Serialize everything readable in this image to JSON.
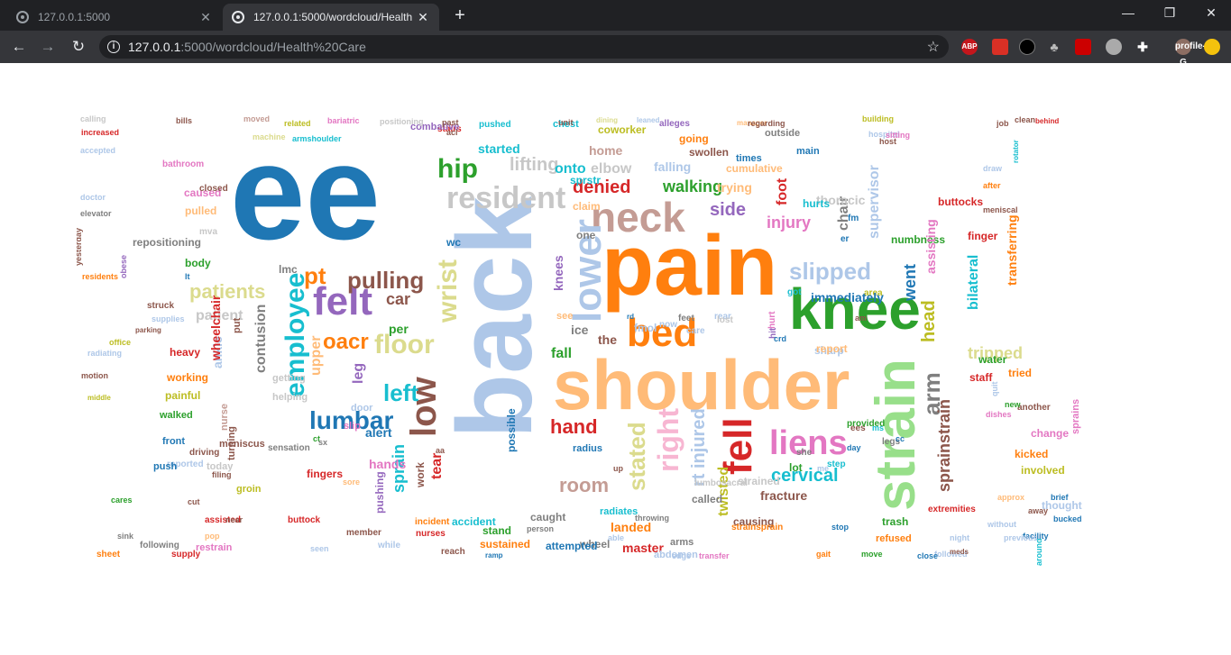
{
  "browser": {
    "tabs": [
      {
        "title": "127.0.0.1:5000",
        "active": false
      },
      {
        "title": "127.0.0.1:5000/wordcloud/Health",
        "active": true
      }
    ],
    "address": {
      "host": "127.0.0.1",
      "path": ":5000/wordcloud/Health%20Care"
    },
    "extensions": [
      "ABP",
      "profile-G"
    ]
  },
  "colors": {
    "tabstrip": "#202124",
    "toolbar": "#35363a",
    "page_bg": "#ffffff"
  },
  "wordcloud": {
    "category": "Health Care",
    "words": [
      {
        "text": "ee",
        "color": "#1f77b4"
      },
      {
        "text": "back",
        "color": "#aec7e8"
      },
      {
        "text": "pain",
        "color": "#ff7f0e"
      },
      {
        "text": "shoulder",
        "color": "#ffbb78"
      },
      {
        "text": "knee",
        "color": "#2ca02c"
      },
      {
        "text": "strain",
        "color": "#98df8a"
      },
      {
        "text": "neck",
        "color": "#c49c94"
      },
      {
        "text": "lower",
        "color": "#aec7e8"
      },
      {
        "text": "felt",
        "color": "#9467bd"
      },
      {
        "text": "bed",
        "color": "#ff7f0e"
      },
      {
        "text": "fell",
        "color": "#d62728"
      },
      {
        "text": "low",
        "color": "#8c564b"
      },
      {
        "text": "resident",
        "color": "#c7c7c7"
      },
      {
        "text": "employee",
        "color": "#17becf"
      },
      {
        "text": "lumbar",
        "color": "#1f77b4"
      },
      {
        "text": "liens",
        "color": "#e377c2"
      },
      {
        "text": "wrist",
        "color": "#dbdb8d"
      },
      {
        "text": "hip",
        "color": "#2ca02c"
      },
      {
        "text": "right",
        "color": "#f7b6d2"
      },
      {
        "text": "arm",
        "color": "#7f7f7f"
      },
      {
        "text": "floor",
        "color": "#dbdb8d"
      },
      {
        "text": "pt",
        "color": "#ff7f0e"
      },
      {
        "text": "pulling",
        "color": "#8c564b"
      },
      {
        "text": "slipped",
        "color": "#aec7e8"
      },
      {
        "text": "patients",
        "color": "#dbdb8d"
      },
      {
        "text": "denied",
        "color": "#d62728"
      },
      {
        "text": "lifting",
        "color": "#c7c7c7"
      },
      {
        "text": "walking",
        "color": "#2ca02c"
      },
      {
        "text": "room",
        "color": "#c49c94"
      },
      {
        "text": "hand",
        "color": "#d62728"
      },
      {
        "text": "left",
        "color": "#17becf"
      },
      {
        "text": "oacr",
        "color": "#ff7f0e"
      },
      {
        "text": "stated",
        "color": "#dbdb8d"
      },
      {
        "text": "rt injured",
        "color": "#aec7e8"
      },
      {
        "text": "cervical",
        "color": "#17becf"
      },
      {
        "text": "sprainstrain",
        "color": "#8c564b"
      },
      {
        "text": "head",
        "color": "#bcbd22"
      },
      {
        "text": "went",
        "color": "#1f77b4"
      },
      {
        "text": "tripped",
        "color": "#dbdb8d"
      },
      {
        "text": "side",
        "color": "#9467bd"
      },
      {
        "text": "injury",
        "color": "#e377c2"
      },
      {
        "text": "foot",
        "color": "#d62728"
      },
      {
        "text": "chair",
        "color": "#7f7f7f"
      },
      {
        "text": "supervisor",
        "color": "#aec7e8"
      },
      {
        "text": "sprain",
        "color": "#17becf"
      },
      {
        "text": "tear",
        "color": "#d62728"
      },
      {
        "text": "twisted",
        "color": "#bcbd22"
      },
      {
        "text": "fracture",
        "color": "#8c564b"
      },
      {
        "text": "bilateral",
        "color": "#17becf"
      },
      {
        "text": "transferring",
        "color": "#ff7f0e"
      },
      {
        "text": "knees",
        "color": "#9467bd"
      },
      {
        "text": "patient",
        "color": "#c7c7c7"
      },
      {
        "text": "contusion",
        "color": "#7f7f7f"
      },
      {
        "text": "upper",
        "color": "#ffbb78"
      },
      {
        "text": "leg",
        "color": "#9467bd"
      },
      {
        "text": "ankle",
        "color": "#aec7e8"
      },
      {
        "text": "wheelchair",
        "color": "#d62728"
      },
      {
        "text": "started",
        "color": "#17becf"
      },
      {
        "text": "home",
        "color": "#c49c94"
      },
      {
        "text": "elbow",
        "color": "#c7c7c7"
      },
      {
        "text": "falling",
        "color": "#aec7e8"
      },
      {
        "text": "trying",
        "color": "#ffbb78"
      },
      {
        "text": "cumulative",
        "color": "#ffbb78"
      },
      {
        "text": "thoracic",
        "color": "#c7c7c7"
      },
      {
        "text": "numbness",
        "color": "#2ca02c"
      },
      {
        "text": "assisting",
        "color": "#e377c2"
      },
      {
        "text": "alert",
        "color": "#1f77b4"
      },
      {
        "text": "hands",
        "color": "#e377c2"
      },
      {
        "text": "fingers",
        "color": "#d62728"
      },
      {
        "text": "pushing",
        "color": "#9467bd"
      },
      {
        "text": "work",
        "color": "#8c564b"
      },
      {
        "text": "landed",
        "color": "#ff7f0e"
      },
      {
        "text": "called",
        "color": "#7f7f7f"
      },
      {
        "text": "causing",
        "color": "#8c564b"
      },
      {
        "text": "strained",
        "color": "#c7c7c7"
      },
      {
        "text": "stand",
        "color": "#2ca02c"
      },
      {
        "text": "accident",
        "color": "#17becf"
      },
      {
        "text": "sustained",
        "color": "#ff7f0e"
      },
      {
        "text": "caught",
        "color": "#7f7f7f"
      },
      {
        "text": "wheel",
        "color": "#7f7f7f"
      },
      {
        "text": "attempted",
        "color": "#1f77b4"
      },
      {
        "text": "master",
        "color": "#d62728"
      },
      {
        "text": "arms",
        "color": "#7f7f7f"
      },
      {
        "text": "abdomen",
        "color": "#aec7e8"
      },
      {
        "text": "strainsprain",
        "color": "#ff7f0e"
      },
      {
        "text": "trash",
        "color": "#2ca02c"
      },
      {
        "text": "refused",
        "color": "#ff7f0e"
      },
      {
        "text": "extremities",
        "color": "#d62728"
      },
      {
        "text": "buttocks",
        "color": "#d62728"
      },
      {
        "text": "finger",
        "color": "#d62728"
      },
      {
        "text": "water",
        "color": "#2ca02c"
      },
      {
        "text": "tried",
        "color": "#ff7f0e"
      },
      {
        "text": "kicked",
        "color": "#ff7f0e"
      },
      {
        "text": "involved",
        "color": "#bcbd22"
      },
      {
        "text": "change",
        "color": "#e377c2"
      },
      {
        "text": "thought",
        "color": "#aec7e8"
      },
      {
        "text": "sprains",
        "color": "#e377c2"
      },
      {
        "text": "staff",
        "color": "#d62728"
      },
      {
        "text": "repositioning",
        "color": "#7f7f7f"
      },
      {
        "text": "body",
        "color": "#2ca02c"
      },
      {
        "text": "caused",
        "color": "#e377c2"
      },
      {
        "text": "pulled",
        "color": "#ffbb78"
      },
      {
        "text": "bathroom",
        "color": "#e377c2"
      },
      {
        "text": "heavy",
        "color": "#d62728"
      },
      {
        "text": "working",
        "color": "#ff7f0e"
      },
      {
        "text": "painful",
        "color": "#bcbd22"
      },
      {
        "text": "walked",
        "color": "#2ca02c"
      },
      {
        "text": "front",
        "color": "#1f77b4"
      },
      {
        "text": "reported",
        "color": "#aec7e8"
      },
      {
        "text": "driving",
        "color": "#8c564b"
      },
      {
        "text": "push",
        "color": "#1f77b4"
      },
      {
        "text": "today",
        "color": "#c7c7c7"
      },
      {
        "text": "meniscus",
        "color": "#8c564b"
      },
      {
        "text": "groin",
        "color": "#bcbd22"
      },
      {
        "text": "assisted",
        "color": "#d62728"
      },
      {
        "text": "restrain",
        "color": "#e377c2"
      },
      {
        "text": "supply",
        "color": "#d62728"
      },
      {
        "text": "sheet",
        "color": "#ff7f0e"
      },
      {
        "text": "following",
        "color": "#7f7f7f"
      },
      {
        "text": "nurses",
        "color": "#d62728"
      },
      {
        "text": "incident",
        "color": "#ff7f0e"
      },
      {
        "text": "member",
        "color": "#8c564b"
      },
      {
        "text": "buttock",
        "color": "#d62728"
      },
      {
        "text": "sensation",
        "color": "#7f7f7f"
      },
      {
        "text": "turning",
        "color": "#8c564b"
      },
      {
        "text": "nurse",
        "color": "#c49c94"
      },
      {
        "text": "getting",
        "color": "#c7c7c7"
      },
      {
        "text": "helping",
        "color": "#c7c7c7"
      },
      {
        "text": "door",
        "color": "#aec7e8"
      },
      {
        "text": "slip",
        "color": "#e377c2"
      },
      {
        "text": "car",
        "color": "#8c564b"
      },
      {
        "text": "per",
        "color": "#2ca02c"
      },
      {
        "text": "fall",
        "color": "#2ca02c"
      },
      {
        "text": "see",
        "color": "#ffbb78"
      },
      {
        "text": "ice",
        "color": "#7f7f7f"
      },
      {
        "text": "the",
        "color": "#8c564b"
      },
      {
        "text": "fmol",
        "color": "#aec7e8"
      },
      {
        "text": "feet",
        "color": "#7f7f7f"
      },
      {
        "text": "hurt",
        "color": "#e377c2"
      },
      {
        "text": "hit",
        "color": "#9467bd"
      },
      {
        "text": "sharp",
        "color": "#aec7e8"
      },
      {
        "text": "report",
        "color": "#ffbb78"
      },
      {
        "text": "she",
        "color": "#7f7f7f"
      },
      {
        "text": "legs",
        "color": "#7f7f7f"
      },
      {
        "text": "step",
        "color": "#17becf"
      },
      {
        "text": "lot",
        "color": "#2ca02c"
      },
      {
        "text": "ees",
        "color": "#8c564b"
      },
      {
        "text": "provided",
        "color": "#2ca02c"
      },
      {
        "text": "lumbosacral",
        "color": "#c7c7c7"
      },
      {
        "text": "coworker",
        "color": "#bcbd22"
      },
      {
        "text": "stairs",
        "color": "#d62728"
      },
      {
        "text": "combative",
        "color": "#9467bd"
      },
      {
        "text": "pushed",
        "color": "#17becf"
      },
      {
        "text": "chest",
        "color": "#17becf"
      },
      {
        "text": "alleges",
        "color": "#9467bd"
      },
      {
        "text": "going",
        "color": "#ff7f0e"
      },
      {
        "text": "swollen",
        "color": "#8c564b"
      },
      {
        "text": "outside",
        "color": "#7f7f7f"
      },
      {
        "text": "times",
        "color": "#1f77b4"
      },
      {
        "text": "main",
        "color": "#1f77b4"
      },
      {
        "text": "hurts",
        "color": "#17becf"
      },
      {
        "text": "got",
        "color": "#17becf"
      },
      {
        "text": "area",
        "color": "#bcbd22"
      },
      {
        "text": "er",
        "color": "#1f77b4"
      },
      {
        "text": "fm",
        "color": "#1f77b4"
      },
      {
        "text": "onto",
        "color": "#17becf"
      },
      {
        "text": "sprstr",
        "color": "#17becf"
      },
      {
        "text": "claim",
        "color": "#ffbb78"
      },
      {
        "text": "one",
        "color": "#7f7f7f"
      },
      {
        "text": "wc",
        "color": "#1f77b4"
      },
      {
        "text": "immediately",
        "color": "#1f77b4"
      },
      {
        "text": "possible",
        "color": "#1f77b4"
      },
      {
        "text": "radius",
        "color": "#1f77b4"
      },
      {
        "text": "radiates",
        "color": "#17becf"
      },
      {
        "text": "calling",
        "color": "#c7c7c7"
      },
      {
        "text": "increased",
        "color": "#d62728"
      },
      {
        "text": "accepted",
        "color": "#aec7e8"
      },
      {
        "text": "doctor",
        "color": "#aec7e8"
      },
      {
        "text": "elevator",
        "color": "#7f7f7f"
      },
      {
        "text": "yesterday",
        "color": "#8c564b"
      },
      {
        "text": "residents",
        "color": "#ff7f0e"
      },
      {
        "text": "radiating",
        "color": "#aec7e8"
      },
      {
        "text": "motion",
        "color": "#8c564b"
      },
      {
        "text": "office",
        "color": "#bcbd22"
      },
      {
        "text": "middle",
        "color": "#bcbd22"
      },
      {
        "text": "parking",
        "color": "#8c564b"
      },
      {
        "text": "struck",
        "color": "#8c564b"
      },
      {
        "text": "supplies",
        "color": "#aec7e8"
      },
      {
        "text": "obese",
        "color": "#9467bd"
      },
      {
        "text": "moved",
        "color": "#c49c94"
      },
      {
        "text": "related",
        "color": "#bcbd22"
      },
      {
        "text": "armshoulder",
        "color": "#17becf"
      },
      {
        "text": "bariatric",
        "color": "#e377c2"
      },
      {
        "text": "positioning",
        "color": "#c7c7c7"
      },
      {
        "text": "machine",
        "color": "#dbdb8d"
      },
      {
        "text": "bills",
        "color": "#8c564b"
      },
      {
        "text": "dining",
        "color": "#dbdb8d"
      },
      {
        "text": "leaned",
        "color": "#aec7e8"
      },
      {
        "text": "manager",
        "color": "#ffbb78"
      },
      {
        "text": "regarding",
        "color": "#8c564b"
      },
      {
        "text": "building",
        "color": "#bcbd22"
      },
      {
        "text": "clean",
        "color": "#8c564b"
      },
      {
        "text": "hospital",
        "color": "#aec7e8"
      },
      {
        "text": "sitting",
        "color": "#e377c2"
      },
      {
        "text": "after",
        "color": "#ff7f0e"
      },
      {
        "text": "meniscal",
        "color": "#8c564b"
      },
      {
        "text": "draw",
        "color": "#aec7e8"
      },
      {
        "text": "rotator",
        "color": "#17becf"
      },
      {
        "text": "behind",
        "color": "#d62728"
      },
      {
        "text": "another",
        "color": "#8c564b"
      },
      {
        "text": "new",
        "color": "#2ca02c"
      },
      {
        "text": "dishes",
        "color": "#e377c2"
      },
      {
        "text": "quit",
        "color": "#aec7e8"
      },
      {
        "text": "approx",
        "color": "#ffbb78"
      },
      {
        "text": "away",
        "color": "#8c564b"
      },
      {
        "text": "bucked",
        "color": "#1f77b4"
      },
      {
        "text": "brief",
        "color": "#1f77b4"
      },
      {
        "text": "facility",
        "color": "#1f77b4"
      },
      {
        "text": "around",
        "color": "#17becf"
      },
      {
        "text": "previous",
        "color": "#aec7e8"
      },
      {
        "text": "without",
        "color": "#aec7e8"
      },
      {
        "text": "followed",
        "color": "#aec7e8"
      },
      {
        "text": "night",
        "color": "#aec7e8"
      },
      {
        "text": "meds",
        "color": "#8c564b"
      },
      {
        "text": "close",
        "color": "#1f77b4"
      },
      {
        "text": "gait",
        "color": "#ff7f0e"
      },
      {
        "text": "move",
        "color": "#2ca02c"
      },
      {
        "text": "stop",
        "color": "#1f77b4"
      },
      {
        "text": "while",
        "color": "#aec7e8"
      },
      {
        "text": "ramp",
        "color": "#1f77b4"
      },
      {
        "text": "reach",
        "color": "#8c564b"
      },
      {
        "text": "person",
        "color": "#7f7f7f"
      },
      {
        "text": "able",
        "color": "#aec7e8"
      },
      {
        "text": "edge",
        "color": "#aec7e8"
      },
      {
        "text": "throwing",
        "color": "#7f7f7f"
      },
      {
        "text": "transfer",
        "color": "#e377c2"
      },
      {
        "text": "seen",
        "color": "#aec7e8"
      },
      {
        "text": "put",
        "color": "#8c564b"
      },
      {
        "text": "lt",
        "color": "#1f77b4"
      },
      {
        "text": "lmc",
        "color": "#7f7f7f"
      },
      {
        "text": "mva",
        "color": "#c7c7c7"
      },
      {
        "text": "closed",
        "color": "#8c564b"
      },
      {
        "text": "filing",
        "color": "#8c564b"
      },
      {
        "text": "cut",
        "color": "#8c564b"
      },
      {
        "text": "cares",
        "color": "#2ca02c"
      },
      {
        "text": "sink",
        "color": "#7f7f7f"
      },
      {
        "text": "near",
        "color": "#8c564b"
      },
      {
        "text": "pop",
        "color": "#ffbb78"
      },
      {
        "text": "ct",
        "color": "#2ca02c"
      },
      {
        "text": "sore",
        "color": "#ffbb78"
      },
      {
        "text": "care",
        "color": "#aec7e8"
      },
      {
        "text": "now",
        "color": "#aec7e8"
      },
      {
        "text": "rd",
        "color": "#1f77b4"
      },
      {
        "text": "rear",
        "color": "#aec7e8"
      },
      {
        "text": "crd",
        "color": "#1f77b4"
      },
      {
        "text": "am",
        "color": "#8c564b"
      },
      {
        "text": "me",
        "color": "#aec7e8"
      },
      {
        "text": "ms",
        "color": "#17becf"
      },
      {
        "text": "day",
        "color": "#1f77b4"
      },
      {
        "text": "cc",
        "color": "#1f77b4"
      },
      {
        "text": "aa",
        "color": "#8c564b"
      },
      {
        "text": "up",
        "color": "#8c564b"
      },
      {
        "text": "sx",
        "color": "#7f7f7f"
      },
      {
        "text": "lost",
        "color": "#c7c7c7"
      },
      {
        "text": "unit",
        "color": "#8c564b"
      },
      {
        "text": "past",
        "color": "#8c564b"
      },
      {
        "text": "acl",
        "color": "#8c564b"
      },
      {
        "text": "host",
        "color": "#8c564b"
      },
      {
        "text": "job",
        "color": "#8c564b"
      }
    ]
  }
}
